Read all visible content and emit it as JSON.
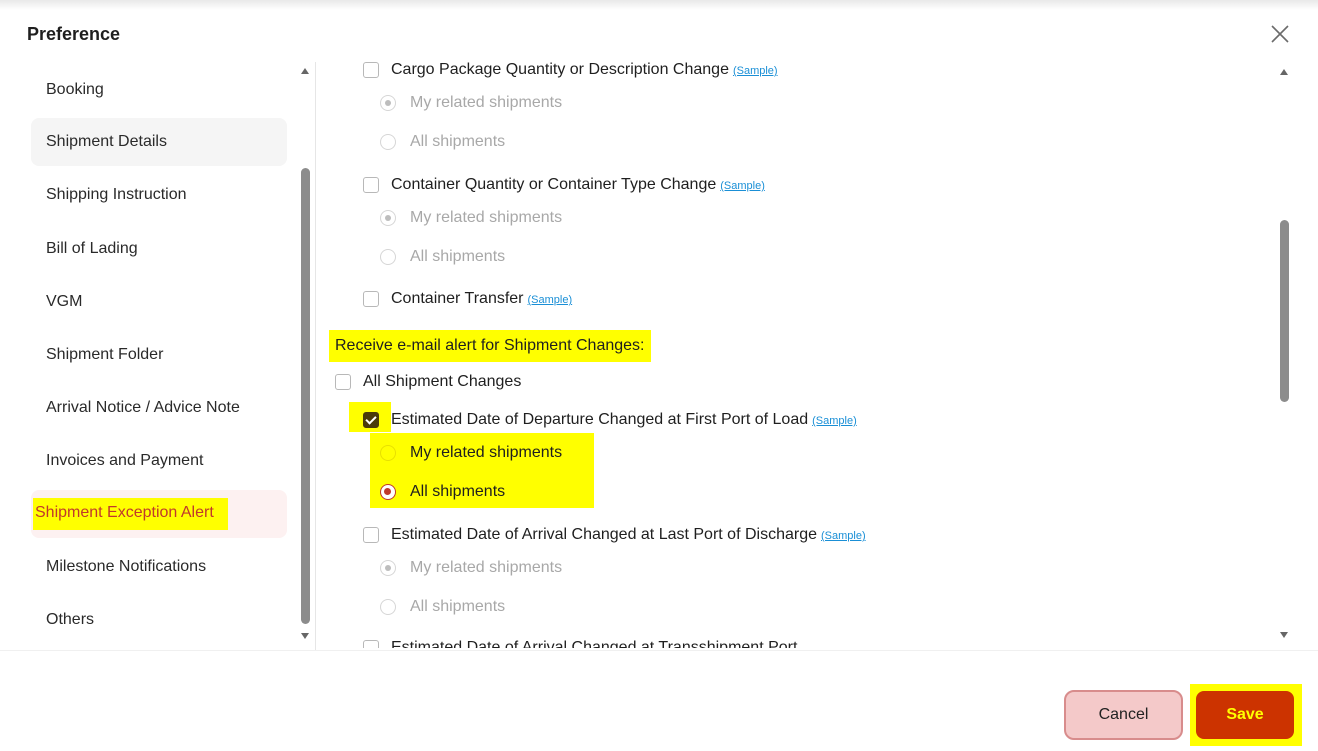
{
  "dialog": {
    "title": "Preference",
    "close_icon": "close-icon"
  },
  "nav": {
    "items": [
      {
        "label": "Booking"
      },
      {
        "label": "Shipment Details"
      },
      {
        "label": "Shipping Instruction"
      },
      {
        "label": "Bill of Lading"
      },
      {
        "label": "VGM"
      },
      {
        "label": "Shipment Folder"
      },
      {
        "label": "Arrival Notice / Advice Note"
      },
      {
        "label": "Invoices and Payment"
      },
      {
        "label": "Shipment Exception Alert"
      },
      {
        "label": "Milestone Notifications"
      },
      {
        "label": "Others"
      }
    ],
    "active": "Shipment Exception Alert"
  },
  "content": {
    "sample_label": "(Sample)",
    "radio_my": "My related shipments",
    "radio_all": "All shipments",
    "opt_cargo": "Cargo Package Quantity or Description Change",
    "opt_container_qty": "Container Quantity or Container Type Change",
    "opt_container_transfer": "Container Transfer",
    "section_heading": "Receive e-mail alert for Shipment Changes:",
    "opt_all_changes": "All Shipment Changes",
    "opt_etd_first_pol": "Estimated Date of Departure Changed at First Port of Load",
    "opt_eta_last_pod": "Estimated Date of Arrival Changed at Last Port of Discharge",
    "opt_eta_transhipment": "Estimated Date of Arrival Changed at Transshipment Port"
  },
  "footer": {
    "cancel_label": "Cancel",
    "save_label": "Save"
  },
  "colors": {
    "accent": "#cc3300",
    "highlight": "#ffff00",
    "link": "#1a8fd6"
  }
}
